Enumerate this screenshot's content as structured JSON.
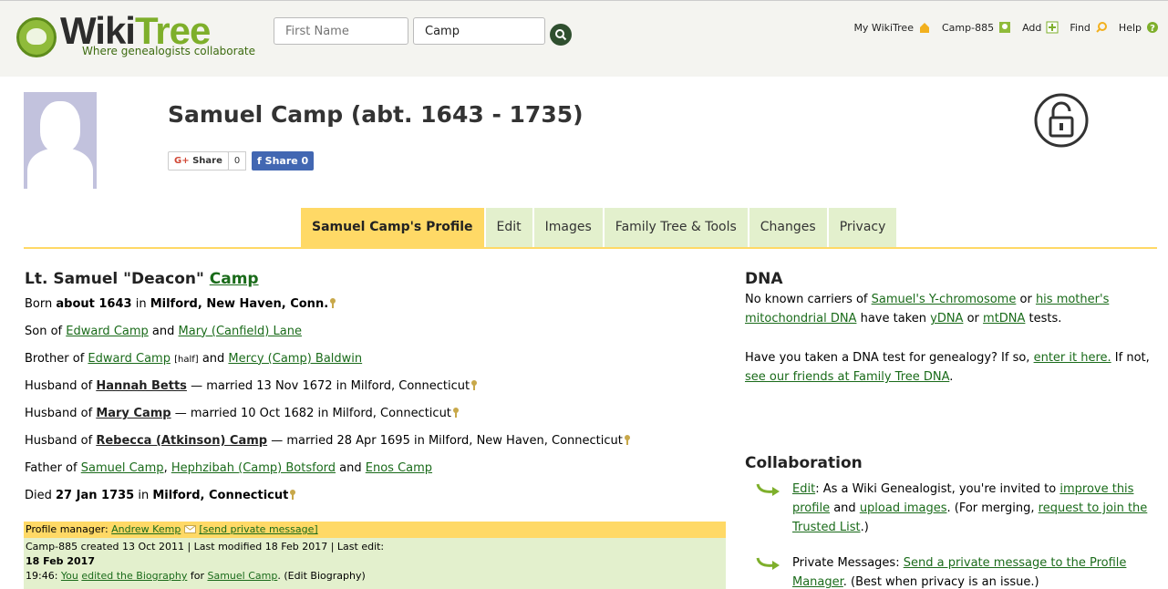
{
  "colors": {
    "accent_yellow": "#ffd966",
    "tab_green": "#e3f0cd",
    "link_green": "#1a6b1a",
    "brand_green": "#7eaf2b"
  },
  "header": {
    "logo_wiki": "Wiki",
    "logo_tree": "Tree",
    "logo_tagline": "Where genealogists collaborate",
    "search_first_placeholder": "First Name",
    "search_last_value": "Camp",
    "nav": [
      {
        "label": "My WikiTree",
        "icon": "house-icon"
      },
      {
        "label": "Camp-885",
        "icon": "profile-icon"
      },
      {
        "label": "Add",
        "icon": "plus-icon"
      },
      {
        "label": "Find",
        "icon": "magnifier-icon"
      },
      {
        "label": "Help",
        "icon": "question-icon"
      }
    ]
  },
  "profile": {
    "title": "Samuel Camp (abt. 1643 - 1735)",
    "gplus_share": "Share",
    "gplus_count": "0",
    "fb_share": "Share 0"
  },
  "tabs": [
    {
      "label": "Samuel Camp's Profile",
      "active": true
    },
    {
      "label": "Edit"
    },
    {
      "label": "Images"
    },
    {
      "label": "Family Tree & Tools"
    },
    {
      "label": "Changes"
    },
    {
      "label": "Privacy"
    }
  ],
  "bio": {
    "prefix": "Lt. Samuel \"Deacon\" ",
    "surname": "Camp",
    "born": {
      "label": "Born",
      "date": "about 1643",
      "in": "in",
      "place": "Milford, New Haven, Conn."
    },
    "son_of": {
      "label": "Son of",
      "father": "Edward Camp",
      "and": "and",
      "mother": "Mary (Canfield) Lane"
    },
    "brother_of": {
      "label": "Brother of",
      "sibling1": "Edward Camp",
      "half": "[half]",
      "and": "and",
      "sibling2": "Mercy (Camp) Baldwin"
    },
    "spouses": [
      {
        "label": "Husband of",
        "name": "Hannah Betts",
        "detail": "— married 13 Nov 1672 in Milford, Connecticut"
      },
      {
        "label": "Husband of",
        "name": "Mary Camp",
        "detail": "— married 10 Oct 1682 in Milford, Connecticut"
      },
      {
        "label": "Husband of",
        "name": "Rebecca (Atkinson) Camp",
        "detail": "— married 28 Apr 1695 in Milford, New Haven, Connecticut"
      }
    ],
    "father_of": {
      "label": "Father of",
      "child1": "Samuel Camp",
      "sep": ",",
      "child2": "Hephzibah (Camp) Botsford",
      "and": "and",
      "child3": "Enos Camp"
    },
    "died": {
      "label": "Died",
      "date": "27 Jan 1735",
      "in": "in",
      "place": "Milford, Connecticut"
    }
  },
  "manager": {
    "label": "Profile manager:",
    "name": "Andrew Kemp",
    "pm_link": "[send private message]",
    "created": "Camp-885 created 13 Oct 2011 | Last modified 18 Feb 2017 | Last edit:",
    "last_edit_date": "18 Feb 2017",
    "time": "19:46:",
    "you": "You",
    "edited": "edited the Biography",
    "for": "for",
    "subject": "Samuel Camp",
    "suffix": ". (Edit Biography)"
  },
  "dna": {
    "title": "DNA",
    "p1_text1": "No known carriers of ",
    "p1_link1": "Samuel's Y-chromosome",
    "p1_text2": " or ",
    "p1_link2": "his mother's mitochondrial DNA",
    "p1_text3": " have taken ",
    "p1_link3": "yDNA",
    "p1_text4": " or ",
    "p1_link4": "mtDNA",
    "p1_text5": " tests.",
    "p2_text1": "Have you taken a DNA test for genealogy? If so, ",
    "p2_link1": "enter it here.",
    "p2_text2": " If not, ",
    "p2_link2": "see our friends at Family Tree DNA",
    "p2_text3": "."
  },
  "collaboration": {
    "title": "Collaboration",
    "item1": {
      "link_edit": "Edit",
      "text1": ": As a Wiki Genealogist, you're invited to ",
      "link_improve": "improve this profile",
      "text2": " and ",
      "link_upload": "upload images",
      "text3": ". (For merging, ",
      "link_request": "request to join the Trusted List",
      "text4": ".)"
    },
    "item2": {
      "text1": "Private Messages: ",
      "link_send": "Send a private message to the Profile Manager",
      "text2": ". (Best when privacy is an issue.)"
    }
  }
}
